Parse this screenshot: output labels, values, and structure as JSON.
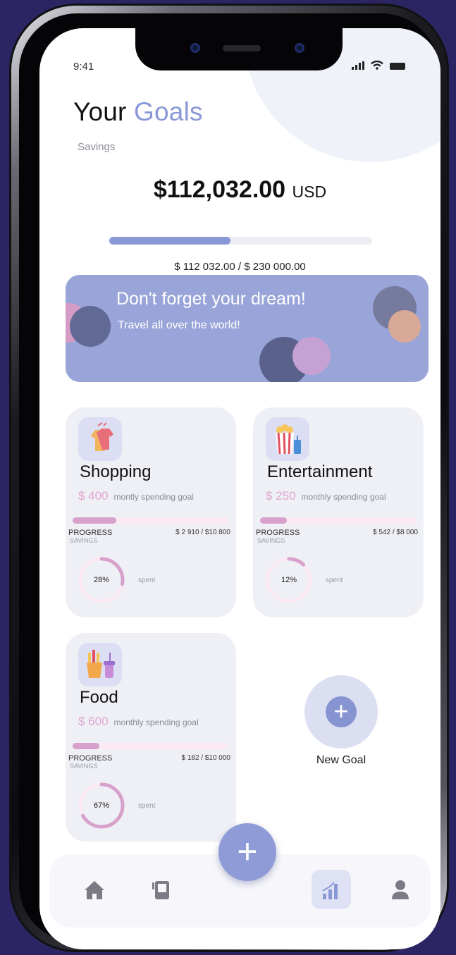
{
  "status_bar": {
    "time": "9:41"
  },
  "header": {
    "title_part1": "Your",
    "title_part2": "Goals"
  },
  "savings": {
    "label": "Savings",
    "amount": "$112,032.00",
    "currency": "USD",
    "progress_fraction": 0.46,
    "progress_text": "$ 112 032.00 / $ 230 000.00"
  },
  "banner": {
    "title": "Don't forget your dream!",
    "subtitle": "Travel all over the world!"
  },
  "goals": [
    {
      "name": "Shopping",
      "icon": "shirt-icon",
      "goal_amount": "$ 400",
      "goal_text": "montly spending goal",
      "progress_label": "PROGRESS",
      "sub_label": "SAVINGS",
      "progress_amount": "$ 2 910 / $10 800",
      "bar_fraction": 0.28,
      "percent": 28,
      "percent_text": "28%",
      "spent_label": "spent"
    },
    {
      "name": "Entertainment",
      "icon": "popcorn-icon",
      "goal_amount": "$ 250",
      "goal_text": "monthly spending goal",
      "progress_label": "PROGRESS",
      "sub_label": "SAVINGS",
      "progress_amount": "$ 542 / $8 000",
      "bar_fraction": 0.17,
      "percent": 12,
      "percent_text": "12%",
      "spent_label": "spent"
    },
    {
      "name": "Food",
      "icon": "fries-icon",
      "goal_amount": "$ 600",
      "goal_text": "monthly spending goal",
      "progress_label": "PROGRESS",
      "sub_label": "SAVINGS",
      "progress_amount": "$ 182 / $10 000",
      "bar_fraction": 0.17,
      "percent": 67,
      "percent_text": "67%",
      "spent_label": "spent"
    }
  ],
  "new_goal": {
    "label": "New Goal",
    "plus": "+"
  },
  "fab": {
    "plus": "+"
  },
  "tabbar": {
    "items": [
      "home-icon",
      "book-icon",
      "chart-icon",
      "profile-icon"
    ],
    "active": "chart-icon"
  },
  "colors": {
    "accent": "#8a98d6",
    "pink": "#d7a1cb",
    "banner": "#99a4d8",
    "background": "#2c2563"
  }
}
